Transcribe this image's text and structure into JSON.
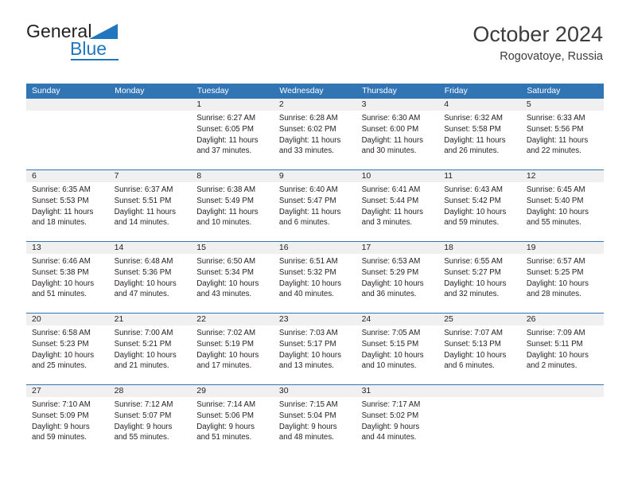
{
  "brand": {
    "name_part1": "General",
    "name_part2": "Blue"
  },
  "header": {
    "title": "October 2024",
    "location": "Rogovatoye, Russia"
  },
  "labels": {
    "sunrise_prefix": "Sunrise:",
    "sunset_prefix": "Sunset:",
    "daylight_prefix": "Daylight:"
  },
  "weekdays": [
    "Sunday",
    "Monday",
    "Tuesday",
    "Wednesday",
    "Thursday",
    "Friday",
    "Saturday"
  ],
  "colors": {
    "header_blue": "#3275b5",
    "brand_blue": "#2176bd",
    "daynum_band": "#f0f0f0",
    "text": "#231f20"
  },
  "weeks": [
    [
      {
        "day": "",
        "sunrise": "",
        "sunset": "",
        "daylight_line1": "",
        "daylight_line2": ""
      },
      {
        "day": "",
        "sunrise": "",
        "sunset": "",
        "daylight_line1": "",
        "daylight_line2": ""
      },
      {
        "day": "1",
        "sunrise": "Sunrise: 6:27 AM",
        "sunset": "Sunset: 6:05 PM",
        "daylight_line1": "Daylight: 11 hours",
        "daylight_line2": "and 37 minutes."
      },
      {
        "day": "2",
        "sunrise": "Sunrise: 6:28 AM",
        "sunset": "Sunset: 6:02 PM",
        "daylight_line1": "Daylight: 11 hours",
        "daylight_line2": "and 33 minutes."
      },
      {
        "day": "3",
        "sunrise": "Sunrise: 6:30 AM",
        "sunset": "Sunset: 6:00 PM",
        "daylight_line1": "Daylight: 11 hours",
        "daylight_line2": "and 30 minutes."
      },
      {
        "day": "4",
        "sunrise": "Sunrise: 6:32 AM",
        "sunset": "Sunset: 5:58 PM",
        "daylight_line1": "Daylight: 11 hours",
        "daylight_line2": "and 26 minutes."
      },
      {
        "day": "5",
        "sunrise": "Sunrise: 6:33 AM",
        "sunset": "Sunset: 5:56 PM",
        "daylight_line1": "Daylight: 11 hours",
        "daylight_line2": "and 22 minutes."
      }
    ],
    [
      {
        "day": "6",
        "sunrise": "Sunrise: 6:35 AM",
        "sunset": "Sunset: 5:53 PM",
        "daylight_line1": "Daylight: 11 hours",
        "daylight_line2": "and 18 minutes."
      },
      {
        "day": "7",
        "sunrise": "Sunrise: 6:37 AM",
        "sunset": "Sunset: 5:51 PM",
        "daylight_line1": "Daylight: 11 hours",
        "daylight_line2": "and 14 minutes."
      },
      {
        "day": "8",
        "sunrise": "Sunrise: 6:38 AM",
        "sunset": "Sunset: 5:49 PM",
        "daylight_line1": "Daylight: 11 hours",
        "daylight_line2": "and 10 minutes."
      },
      {
        "day": "9",
        "sunrise": "Sunrise: 6:40 AM",
        "sunset": "Sunset: 5:47 PM",
        "daylight_line1": "Daylight: 11 hours",
        "daylight_line2": "and 6 minutes."
      },
      {
        "day": "10",
        "sunrise": "Sunrise: 6:41 AM",
        "sunset": "Sunset: 5:44 PM",
        "daylight_line1": "Daylight: 11 hours",
        "daylight_line2": "and 3 minutes."
      },
      {
        "day": "11",
        "sunrise": "Sunrise: 6:43 AM",
        "sunset": "Sunset: 5:42 PM",
        "daylight_line1": "Daylight: 10 hours",
        "daylight_line2": "and 59 minutes."
      },
      {
        "day": "12",
        "sunrise": "Sunrise: 6:45 AM",
        "sunset": "Sunset: 5:40 PM",
        "daylight_line1": "Daylight: 10 hours",
        "daylight_line2": "and 55 minutes."
      }
    ],
    [
      {
        "day": "13",
        "sunrise": "Sunrise: 6:46 AM",
        "sunset": "Sunset: 5:38 PM",
        "daylight_line1": "Daylight: 10 hours",
        "daylight_line2": "and 51 minutes."
      },
      {
        "day": "14",
        "sunrise": "Sunrise: 6:48 AM",
        "sunset": "Sunset: 5:36 PM",
        "daylight_line1": "Daylight: 10 hours",
        "daylight_line2": "and 47 minutes."
      },
      {
        "day": "15",
        "sunrise": "Sunrise: 6:50 AM",
        "sunset": "Sunset: 5:34 PM",
        "daylight_line1": "Daylight: 10 hours",
        "daylight_line2": "and 43 minutes."
      },
      {
        "day": "16",
        "sunrise": "Sunrise: 6:51 AM",
        "sunset": "Sunset: 5:32 PM",
        "daylight_line1": "Daylight: 10 hours",
        "daylight_line2": "and 40 minutes."
      },
      {
        "day": "17",
        "sunrise": "Sunrise: 6:53 AM",
        "sunset": "Sunset: 5:29 PM",
        "daylight_line1": "Daylight: 10 hours",
        "daylight_line2": "and 36 minutes."
      },
      {
        "day": "18",
        "sunrise": "Sunrise: 6:55 AM",
        "sunset": "Sunset: 5:27 PM",
        "daylight_line1": "Daylight: 10 hours",
        "daylight_line2": "and 32 minutes."
      },
      {
        "day": "19",
        "sunrise": "Sunrise: 6:57 AM",
        "sunset": "Sunset: 5:25 PM",
        "daylight_line1": "Daylight: 10 hours",
        "daylight_line2": "and 28 minutes."
      }
    ],
    [
      {
        "day": "20",
        "sunrise": "Sunrise: 6:58 AM",
        "sunset": "Sunset: 5:23 PM",
        "daylight_line1": "Daylight: 10 hours",
        "daylight_line2": "and 25 minutes."
      },
      {
        "day": "21",
        "sunrise": "Sunrise: 7:00 AM",
        "sunset": "Sunset: 5:21 PM",
        "daylight_line1": "Daylight: 10 hours",
        "daylight_line2": "and 21 minutes."
      },
      {
        "day": "22",
        "sunrise": "Sunrise: 7:02 AM",
        "sunset": "Sunset: 5:19 PM",
        "daylight_line1": "Daylight: 10 hours",
        "daylight_line2": "and 17 minutes."
      },
      {
        "day": "23",
        "sunrise": "Sunrise: 7:03 AM",
        "sunset": "Sunset: 5:17 PM",
        "daylight_line1": "Daylight: 10 hours",
        "daylight_line2": "and 13 minutes."
      },
      {
        "day": "24",
        "sunrise": "Sunrise: 7:05 AM",
        "sunset": "Sunset: 5:15 PM",
        "daylight_line1": "Daylight: 10 hours",
        "daylight_line2": "and 10 minutes."
      },
      {
        "day": "25",
        "sunrise": "Sunrise: 7:07 AM",
        "sunset": "Sunset: 5:13 PM",
        "daylight_line1": "Daylight: 10 hours",
        "daylight_line2": "and 6 minutes."
      },
      {
        "day": "26",
        "sunrise": "Sunrise: 7:09 AM",
        "sunset": "Sunset: 5:11 PM",
        "daylight_line1": "Daylight: 10 hours",
        "daylight_line2": "and 2 minutes."
      }
    ],
    [
      {
        "day": "27",
        "sunrise": "Sunrise: 7:10 AM",
        "sunset": "Sunset: 5:09 PM",
        "daylight_line1": "Daylight: 9 hours",
        "daylight_line2": "and 59 minutes."
      },
      {
        "day": "28",
        "sunrise": "Sunrise: 7:12 AM",
        "sunset": "Sunset: 5:07 PM",
        "daylight_line1": "Daylight: 9 hours",
        "daylight_line2": "and 55 minutes."
      },
      {
        "day": "29",
        "sunrise": "Sunrise: 7:14 AM",
        "sunset": "Sunset: 5:06 PM",
        "daylight_line1": "Daylight: 9 hours",
        "daylight_line2": "and 51 minutes."
      },
      {
        "day": "30",
        "sunrise": "Sunrise: 7:15 AM",
        "sunset": "Sunset: 5:04 PM",
        "daylight_line1": "Daylight: 9 hours",
        "daylight_line2": "and 48 minutes."
      },
      {
        "day": "31",
        "sunrise": "Sunrise: 7:17 AM",
        "sunset": "Sunset: 5:02 PM",
        "daylight_line1": "Daylight: 9 hours",
        "daylight_line2": "and 44 minutes."
      },
      {
        "day": "",
        "sunrise": "",
        "sunset": "",
        "daylight_line1": "",
        "daylight_line2": ""
      },
      {
        "day": "",
        "sunrise": "",
        "sunset": "",
        "daylight_line1": "",
        "daylight_line2": ""
      }
    ]
  ]
}
